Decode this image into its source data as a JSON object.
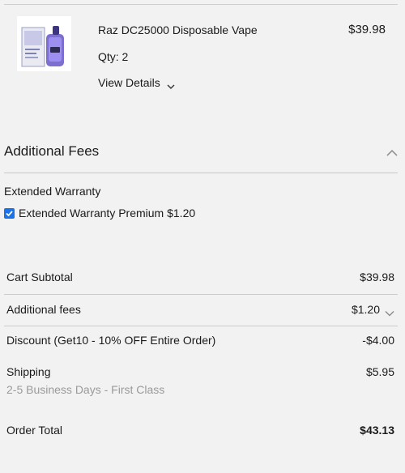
{
  "product": {
    "name": "Raz DC25000 Disposable Vape",
    "price": "$39.98",
    "qty": "Qty: 2",
    "view_details": "View Details",
    "image_icon": "vape-product-image"
  },
  "additional_fees": {
    "heading": "Additional Fees",
    "warranty_title": "Extended Warranty",
    "warranty_option": "Extended Warranty Premium $1.20",
    "warranty_checked": true
  },
  "summary": {
    "subtotal_label": "Cart Subtotal",
    "subtotal_value": "$39.98",
    "fees_label": "Additional fees",
    "fees_value": "$1.20",
    "discount_label": "Discount (Get10 - 10% OFF Entire Order)",
    "discount_value": "-$4.00",
    "shipping_label": "Shipping",
    "shipping_value": "$5.95",
    "shipping_method": "2-5 Business Days - First Class",
    "total_label": "Order Total",
    "total_value": "$43.13"
  },
  "colors": {
    "background": "#f2f2f2",
    "checkbox": "#1a73e8",
    "muted_text": "#9a9a9a"
  }
}
